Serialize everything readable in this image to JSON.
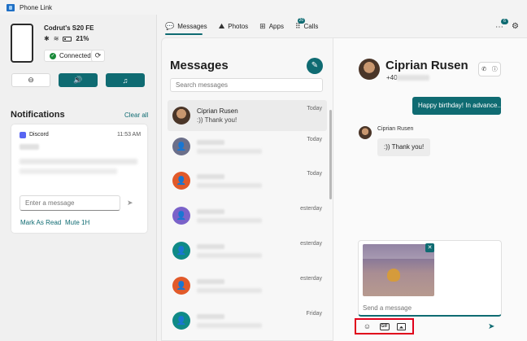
{
  "window": {
    "title": "Phone Link"
  },
  "device": {
    "name": "Codrut's S20 FE",
    "battery": "21%",
    "connection": "Connected"
  },
  "notifications": {
    "title": "Notifications",
    "clear_all": "Clear all",
    "card": {
      "app": "Discord",
      "time": "11:53 AM",
      "reply_placeholder": "Enter a message",
      "action_read": "Mark As Read",
      "action_mute": "Mute 1H"
    }
  },
  "nav": {
    "tabs": [
      {
        "label": "Messages",
        "active": true
      },
      {
        "label": "Photos"
      },
      {
        "label": "Apps"
      },
      {
        "label": "Calls",
        "badge": "20"
      }
    ],
    "notification_badge": "6"
  },
  "messages": {
    "title": "Messages",
    "search_placeholder": "Search messages",
    "conversations": [
      {
        "name": "Ciprian Rusen",
        "preview": ":)) Thank you!",
        "time": "Today",
        "color": "photo"
      },
      {
        "time": "Today",
        "color": "#6b6f8a"
      },
      {
        "time": "Today",
        "color": "#e15a2a"
      },
      {
        "time": "esterday",
        "color": "#7a62c9"
      },
      {
        "time": "esterday",
        "color": "#0f8a86"
      },
      {
        "time": "esterday",
        "color": "#e15a2a"
      },
      {
        "time": "Friday",
        "color": "#0f8a86"
      }
    ]
  },
  "conversation": {
    "contact_name": "Ciprian Rusen",
    "contact_number": "+40",
    "sent_message": "Happy birthday! In advance...",
    "received_name": "Ciprian Rusen",
    "received_message": ":)) Thank you!",
    "compose_placeholder": "Send a message",
    "gif_label": "GIF"
  },
  "colors": {
    "accent": "#0f6b72",
    "highlight_box": "#e0001b"
  }
}
